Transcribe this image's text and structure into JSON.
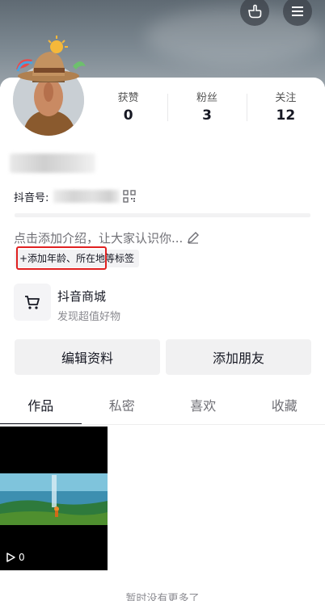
{
  "header": {
    "hand_icon": "pointing-hand-icon",
    "menu_icon": "menu-icon"
  },
  "stats": [
    {
      "label": "获赞",
      "value": "0"
    },
    {
      "label": "粉丝",
      "value": "3"
    },
    {
      "label": "关注",
      "value": "12"
    }
  ],
  "profile": {
    "id_label": "抖音号:",
    "intro_placeholder": "点击添加介绍，让大家认识你...",
    "tag_button": "+添加年龄、所在地等标签"
  },
  "shop": {
    "title": "抖音商城",
    "subtitle": "发现超值好物"
  },
  "actions": {
    "edit": "编辑资料",
    "add_friend": "添加朋友"
  },
  "tabs": [
    {
      "label": "作品",
      "active": true
    },
    {
      "label": "私密",
      "active": false
    },
    {
      "label": "喜欢",
      "active": false
    },
    {
      "label": "收藏",
      "active": false
    }
  ],
  "videos": [
    {
      "play_count": "0"
    }
  ],
  "footer": {
    "no_more": "暂时没有更多了"
  },
  "colors": {
    "highlight_box": "#e02020",
    "text_primary": "#161823",
    "text_secondary": "#6f6f75"
  }
}
